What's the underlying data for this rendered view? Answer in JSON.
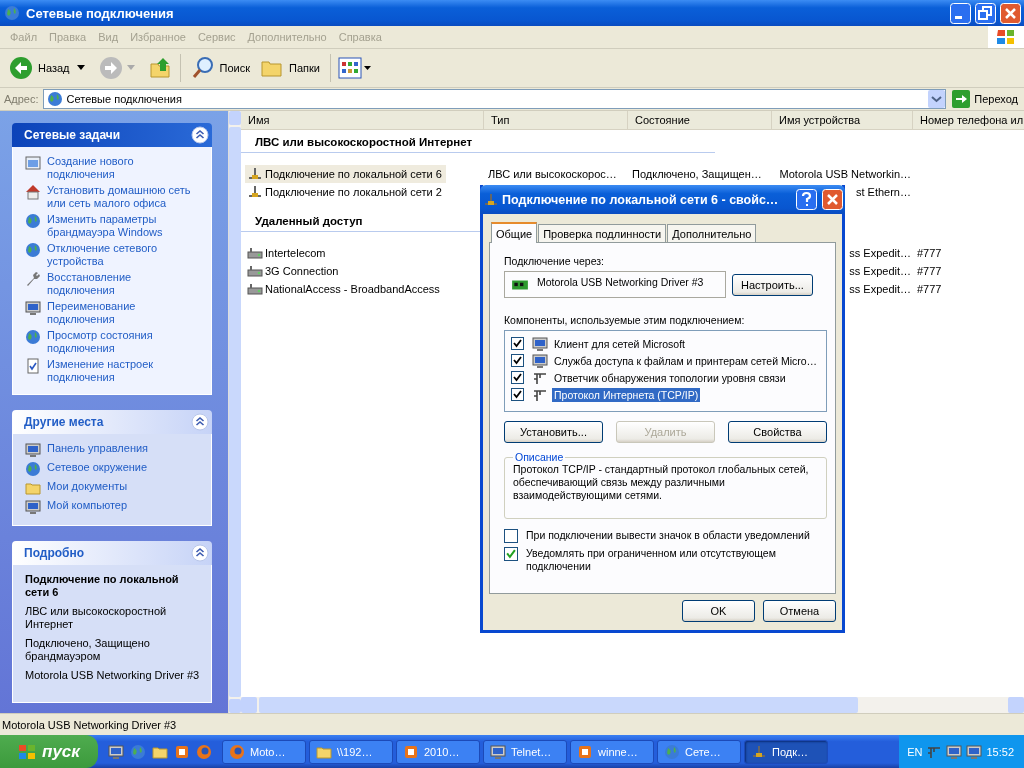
{
  "window": {
    "title": "Сетевые подключения"
  },
  "menu": [
    "Файл",
    "Правка",
    "Вид",
    "Избранное",
    "Сервис",
    "Дополнительно",
    "Справка"
  ],
  "toolbar": {
    "back": "Назад",
    "search": "Поиск",
    "folders": "Папки"
  },
  "address": {
    "label": "Адрес:",
    "value": "Сетевые подключения",
    "go": "Переход"
  },
  "sidebar": [
    {
      "kind": "tasks",
      "title": "Сетевые задачи",
      "items": [
        "Создание нового подключения",
        "Установить домашнюю сеть или сеть малого офиса",
        "Изменить параметры брандмауэра Windows",
        "Отключение сетевого устройства",
        "Восстановление подключения",
        "Переименование подключения",
        "Просмотр состояния подключения",
        "Изменение настроек подключения"
      ]
    },
    {
      "kind": "places",
      "title": "Другие места",
      "items": [
        "Панель управления",
        "Сетевое окружение",
        "Мои документы",
        "Мой компьютер"
      ]
    },
    {
      "kind": "details",
      "title": "Подробно",
      "heading": "Подключение по локальной сети 6",
      "lines": [
        "ЛВС или высокоскоростной Интернет",
        "Подключено, Защищено брандмауэром",
        "Motorola USB Networking Driver #3"
      ]
    }
  ],
  "list": {
    "columns": [
      "Имя",
      "Тип",
      "Состояние",
      "Имя устройства",
      "Номер телефона ил"
    ],
    "groups": [
      {
        "kind": "lan",
        "title": "ЛВС или высокоскоростной Интернет",
        "rows": [
          {
            "name": "Подключение по локальной сети 6",
            "type": "ЛВС или высокоскорос…",
            "status": "Подключено, Защищен…",
            "device": "Motorola USB Networkin…",
            "selected": true
          },
          {
            "name": "Подключение по локальной сети 2",
            "device": "st Ethern…",
            "selected": false
          }
        ]
      },
      {
        "kind": "dialup",
        "title": "Удаленный доступ",
        "rows": [
          {
            "name": "Intertelecom",
            "device": "ss Expedit…",
            "phone": "#777",
            "selected": false
          },
          {
            "name": "3G Connection",
            "device": "ss Expedit…",
            "phone": "#777",
            "selected": false
          },
          {
            "name": "NationalAccess - BroadbandAccess",
            "device": "ss Expedit…",
            "phone": "#777",
            "selected": false
          }
        ]
      }
    ]
  },
  "dialog": {
    "title": "Подключение по локальной сети 6 - свойс…",
    "tabs": [
      {
        "label": "Общие",
        "selected": true
      },
      {
        "label": "Проверка подлинности",
        "selected": false
      },
      {
        "label": "Дополнительно",
        "selected": false
      }
    ],
    "connect_label": "Подключение через:",
    "adapter": "Motorola USB Networking Driver #3",
    "configure": "Настроить...",
    "components_label": "Компоненты, используемые этим подключением:",
    "components": [
      {
        "kind": "client",
        "label": "Клиент для сетей Microsoft",
        "checked": true,
        "selected": false
      },
      {
        "kind": "service",
        "label": "Служба доступа к файлам и принтерам сетей Micro…",
        "checked": true,
        "selected": false
      },
      {
        "kind": "protocol",
        "label": "Ответчик обнаружения топологии уровня связи",
        "checked": true,
        "selected": false
      },
      {
        "kind": "protocol",
        "label": "Протокол Интернета (TCP/IP)",
        "checked": true,
        "selected": true
      }
    ],
    "buttons": [
      {
        "label": "Установить...",
        "disabled": false
      },
      {
        "label": "Удалить",
        "disabled": true
      },
      {
        "label": "Свойства",
        "disabled": false
      }
    ],
    "description": {
      "title": "Описание",
      "text": "Протокол TCP/IP - стандартный протокол глобальных сетей, обеспечивающий связь между различными взаимодействующими сетями."
    },
    "options": [
      {
        "label": "При подключении вывести значок в области уведомлений",
        "checked": false
      },
      {
        "label": "Уведомлять при ограниченном или отсутствующем подключении",
        "checked": true
      }
    ],
    "footer": [
      "OK",
      "Отмена"
    ]
  },
  "status_bar": "Motorola USB Networking Driver #3",
  "taskbar": {
    "start": "пуск",
    "tasks": [
      {
        "label": "Moto…",
        "selected": false
      },
      {
        "label": "\\\\192…",
        "selected": false
      },
      {
        "label": "2010…",
        "selected": false
      },
      {
        "label": "Telnet…",
        "selected": false
      },
      {
        "label": "winne…",
        "selected": false
      },
      {
        "label": "Сете…",
        "selected": false
      },
      {
        "label": "Подк…",
        "selected": true
      }
    ],
    "lang": "EN",
    "clock": "15:52"
  }
}
